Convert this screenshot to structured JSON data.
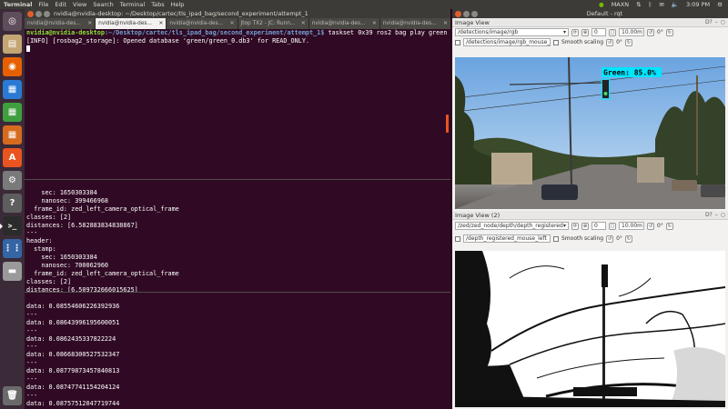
{
  "topbar": {
    "app": "Terminal",
    "menu": [
      "File",
      "Edit",
      "View",
      "Search",
      "Terminal",
      "Tabs",
      "Help"
    ],
    "tray": {
      "power_mode": "MAXN",
      "time": "3:09 PM"
    }
  },
  "terminal1": {
    "title": "nvidia@nvidia-desktop: ~/Desktop/cartec/tls_ipad_bag/second_experiment/attempt_1",
    "tabs": [
      "nvidia@nvidia-des...",
      "nvidia@nvidia-des...",
      "nvidia@nvidia-des...",
      "Jtop TX2 - JC: Runn...",
      "nvidia@nvidia-des...",
      "nvidia@nvidia-des..."
    ],
    "prompt_user": "nvidia@nvidia-desktop",
    "prompt_path": ":~/Desktop/cartec/tls_ipad_bag/second_experiment/attempt_1$",
    "command": " taskset 0x39 ros2 bag play green",
    "output": "[INFO] [rosbag2_storage]: Opened database 'green/green_0.db3' for READ_ONLY."
  },
  "terminal2": {
    "lines": [
      "    sec: 1650303384",
      "    nanosec: 399466968",
      "  frame_id: zed_left_camera_optical_frame",
      "classes: [2]",
      "distances: [6.582883834838867]",
      "---",
      "header:",
      "  stamp:",
      "    sec: 1650303384",
      "    nanosec: 700062960",
      "  frame_id: zed_left_camera_optical_frame",
      "classes: [2]",
      "distances: [6.509732666015625]",
      "---"
    ]
  },
  "terminal3": {
    "lines": [
      "data: 0.08554606226392936",
      "---",
      "data: 0.08643996195600051",
      "---",
      "data: 0.0862435337822224",
      "---",
      "data: 0.08668300527532347",
      "---",
      "data: 0.08779873457840813",
      "---",
      "data: 0.08747741154204124",
      "---",
      "data: 0.08757512047719744",
      "---"
    ]
  },
  "rqt": {
    "title": "Default - rqt",
    "view1": {
      "title": "Image View",
      "topic": "/detections/image/rgb",
      "mouse_topic": "/detections/image/rgb_mouse_left",
      "smooth_label": "Smooth scaling",
      "spin_value": "0",
      "distance": "10.00m",
      "rotation": "0°",
      "detection_label": "Green:  85.0%"
    },
    "view2": {
      "title": "Image View (2)",
      "topic": "/zed/zed_node/depth/depth_registered",
      "mouse_topic": "/depth_registered_mouse_left",
      "smooth_label": "Smooth scaling",
      "spin_value": "0",
      "distance": "10.00m",
      "rotation": "0°"
    }
  }
}
